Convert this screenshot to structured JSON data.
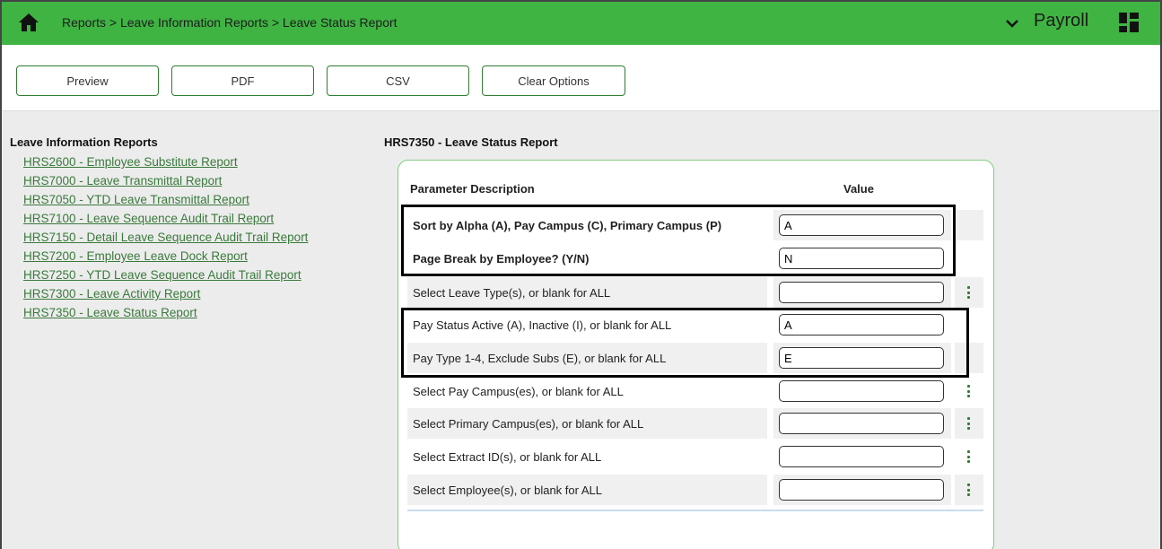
{
  "header": {
    "breadcrumb": "Reports > Leave Information Reports > Leave Status Report",
    "app_name": "Payroll",
    "bar_color": "#3fb443",
    "icons": {
      "home": "home-icon",
      "chevron": "chevron-down-icon",
      "apps": "apps-grid-icon"
    }
  },
  "toolbar": {
    "preview_label": "Preview",
    "pdf_label": "PDF",
    "csv_label": "CSV",
    "clear_label": "Clear Options"
  },
  "sidebar": {
    "title": "Leave Information Reports",
    "links": [
      "HRS2600 - Employee Substitute Report",
      "HRS7000 - Leave Transmittal Report",
      "HRS7050 - YTD Leave Transmittal Report",
      "HRS7100 - Leave Sequence Audit Trail Report",
      "HRS7150 - Detail Leave Sequence Audit Trail Report",
      "HRS7200 - Employee Leave Dock Report",
      "HRS7250 - YTD Leave Sequence Audit Trail Report",
      "HRS7300 - Leave Activity Report",
      "HRS7350 - Leave Status Report"
    ]
  },
  "report": {
    "title": "HRS7350 - Leave Status Report",
    "col_desc": "Parameter Description",
    "col_value": "Value",
    "params": [
      {
        "label": "Sort by Alpha (A), Pay Campus (C), Primary Campus (P)",
        "value": "A",
        "bold": true,
        "lookup": false
      },
      {
        "label": "Page Break by Employee? (Y/N)",
        "value": "N",
        "bold": true,
        "lookup": false
      },
      {
        "label": "Select Leave Type(s), or blank for ALL",
        "value": "",
        "bold": false,
        "lookup": true
      },
      {
        "label": "Pay Status Active (A), Inactive (I), or blank for ALL",
        "value": "A",
        "bold": false,
        "lookup": false
      },
      {
        "label": "Pay Type 1-4, Exclude Subs (E), or blank for ALL",
        "value": "E",
        "bold": false,
        "lookup": false
      },
      {
        "label": "Select Pay Campus(es), or blank for ALL",
        "value": "",
        "bold": false,
        "lookup": true
      },
      {
        "label": "Select Primary Campus(es), or blank for ALL",
        "value": "",
        "bold": false,
        "lookup": true
      },
      {
        "label": "Select Extract ID(s), or blank for ALL",
        "value": "",
        "bold": false,
        "lookup": true
      },
      {
        "label": "Select Employee(s), or blank for ALL",
        "value": "",
        "bold": false,
        "lookup": true
      }
    ]
  }
}
